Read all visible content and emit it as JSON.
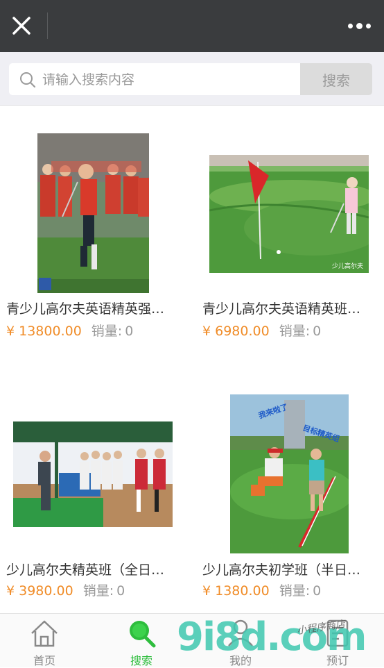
{
  "topbar": {
    "close_icon": "close-icon",
    "more_icon": "more-icon"
  },
  "search": {
    "placeholder": "请输入搜索内容",
    "button_label": "搜索"
  },
  "products": [
    {
      "name": "青少儿高尔夫英语精英强…",
      "price": "¥ 13800.00",
      "sales_label": "销量:",
      "sales_value": "0"
    },
    {
      "name": "青少儿高尔夫英语精英班…",
      "price": "¥ 6980.00",
      "sales_label": "销量:",
      "sales_value": "0"
    },
    {
      "name": "少儿高尔夫精英班（全日…",
      "price": "¥ 3980.00",
      "sales_label": "销量:",
      "sales_value": "0"
    },
    {
      "name": "少儿高尔夫初学班（半日…",
      "price": "¥ 1380.00",
      "sales_label": "销量:",
      "sales_value": "0"
    }
  ],
  "photo_text": {
    "caption_golf": "少儿高尔夫",
    "banner_left": "我来啦了",
    "banner_right": "目标精英组"
  },
  "nav": [
    {
      "label": "首页",
      "icon": "home-icon",
      "active": false
    },
    {
      "label": "搜索",
      "icon": "search-icon",
      "active": true
    },
    {
      "label": "我的",
      "icon": "user-icon",
      "active": false
    },
    {
      "label": "预订",
      "icon": "order-icon",
      "active": false
    }
  ],
  "watermark": {
    "brand": "9i8d.com",
    "script": "小程序商店"
  },
  "colors": {
    "topbar": "#3a3c3e",
    "price": "#f08c28",
    "active_nav": "#2ebd3d",
    "search_button_bg": "#dcdcdc"
  }
}
